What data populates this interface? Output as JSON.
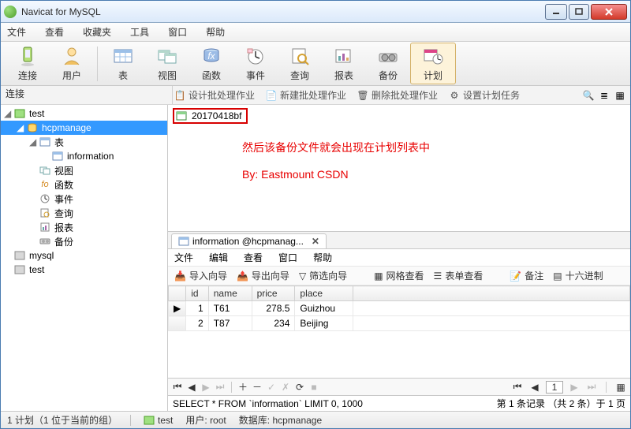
{
  "title": "Navicat for MySQL",
  "menus": {
    "file": "文件",
    "view": "查看",
    "fav": "收藏夹",
    "tools": "工具",
    "window": "窗口",
    "help": "帮助"
  },
  "toolbar": {
    "connect": "连接",
    "user": "用户",
    "table": "表",
    "vw": "视图",
    "func": "函数",
    "event": "事件",
    "query": "查询",
    "report": "报表",
    "backup": "备份",
    "plan": "计划"
  },
  "subtool": {
    "design": "设计批处理作业",
    "new": "新建批处理作业",
    "del": "删除批处理作业",
    "task": "设置计划任务"
  },
  "sidebar": {
    "header": "连接",
    "nodes": {
      "test": "test",
      "hcpmanage": "hcpmanage",
      "tables": "表",
      "information": "information",
      "views": "视图",
      "funcs": "函数",
      "events": "事件",
      "queries": "查询",
      "reports": "报表",
      "backups": "备份",
      "mysql": "mysql",
      "test2": "test"
    }
  },
  "file_chip": "20170418bf",
  "annot": "然后该备份文件就会出现在计划列表中",
  "annot2": "By: Eastmount CSDN",
  "tab": {
    "title": "information @hcpmanag...",
    "menus": {
      "file": "文件",
      "edit": "编辑",
      "view": "查看",
      "window": "窗口",
      "help": "帮助"
    },
    "tools": {
      "import": "导入向导",
      "export": "导出向导",
      "filter": "筛选向导",
      "gridview": "网格查看",
      "formview": "表单查看",
      "memo": "备注",
      "hex": "十六进制"
    }
  },
  "grid": {
    "headers": {
      "id": "id",
      "name": "name",
      "price": "price",
      "place": "place"
    },
    "rows": [
      {
        "ptr": "▶",
        "id": "1",
        "name": "T61",
        "price": "278.5",
        "place": "Guizhou"
      },
      {
        "ptr": "",
        "id": "2",
        "name": "T87",
        "price": "234",
        "place": "Beijing"
      }
    ]
  },
  "sql": "SELECT * FROM `information` LIMIT 0, 1000",
  "recinfo": "第 1 条记录 （共 2 条）于 1 页",
  "status": {
    "plans": "1 计划（1 位于当前的组）",
    "conn": "test",
    "userlbl": "用户:",
    "user": "root",
    "dblbl": "数据库:",
    "db": "hcpmanage"
  }
}
